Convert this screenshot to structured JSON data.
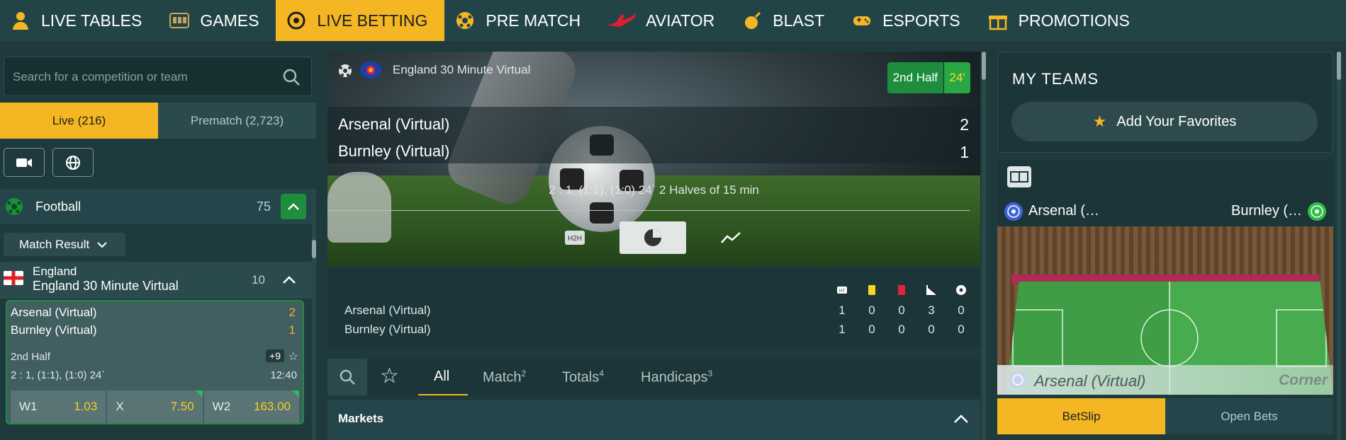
{
  "nav": {
    "items": [
      {
        "label": "LIVE TABLES",
        "icon": "dealer-icon"
      },
      {
        "label": "GAMES",
        "icon": "slot-machine-icon"
      },
      {
        "label": "LIVE BETTING",
        "icon": "live-betting-icon",
        "active": true
      },
      {
        "label": "PRE MATCH",
        "icon": "soccer-ball-icon"
      },
      {
        "label": "AVIATOR",
        "icon": "plane-icon"
      },
      {
        "label": "BLAST",
        "icon": "blast-icon"
      },
      {
        "label": "ESPORTS",
        "icon": "gamepad-icon"
      },
      {
        "label": "PROMOTIONS",
        "icon": "gift-icon"
      }
    ]
  },
  "sidebar": {
    "search_placeholder": "Search for a competition or team",
    "tabs": {
      "live": "Live (216)",
      "prematch": "Prematch (2,723)"
    },
    "sport": {
      "name": "Football",
      "count": "75"
    },
    "market_select": "Match Result",
    "league": {
      "country": "England",
      "name": "England 30 Minute Virtual",
      "count": "10"
    },
    "match": {
      "home": "Arsenal (Virtual)",
      "away": "Burnley (Virtual)",
      "home_score": "2",
      "away_score": "1",
      "period": "2nd Half",
      "more_markets": "+9",
      "score_detail": "2 : 1, (1:1), (1:0) 24`",
      "time": "12:40",
      "odds": [
        {
          "label": "W1",
          "value": "1.03"
        },
        {
          "label": "X",
          "value": "7.50"
        },
        {
          "label": "W2",
          "value": "163.00"
        }
      ]
    }
  },
  "hero": {
    "league": "England 30 Minute Virtual",
    "period": "2nd Half",
    "minute": "24'",
    "home": "Arsenal (Virtual)",
    "away": "Burnley (Virtual)",
    "home_score": "2",
    "away_score": "1",
    "info": "2 : 1, (1:1), (1:0) 24` 2 Halves of 15 min",
    "h2h_label": "H2H"
  },
  "stats": {
    "columns": [
      "half-time-icon",
      "yellow-card-icon",
      "red-card-icon",
      "corner-icon",
      "goals-icon"
    ],
    "rows": [
      {
        "team": "Arsenal (Virtual)",
        "values": [
          "1",
          "0",
          "0",
          "3",
          "0"
        ]
      },
      {
        "team": "Burnley (Virtual)",
        "values": [
          "1",
          "0",
          "0",
          "0",
          "0"
        ]
      }
    ]
  },
  "market_tabs": {
    "all": "All",
    "match": "Match",
    "match_count": "2",
    "totals": "Totals",
    "totals_count": "4",
    "handicaps": "Handicaps",
    "handicaps_count": "3"
  },
  "markets_label": "Markets",
  "right": {
    "my_teams_title": "MY TEAMS",
    "add_favorites": "Add Your Favorites",
    "pitch_home": "Arsenal (…",
    "pitch_away": "Burnley (…",
    "pitch_event_team": "Arsenal (Virtual)",
    "pitch_event": "Corner",
    "betslip": "BetSlip",
    "open_bets": "Open Bets"
  },
  "colors": {
    "accent": "#f5b623",
    "green": "#1e8e3e",
    "bg": "#1f3a3d"
  }
}
